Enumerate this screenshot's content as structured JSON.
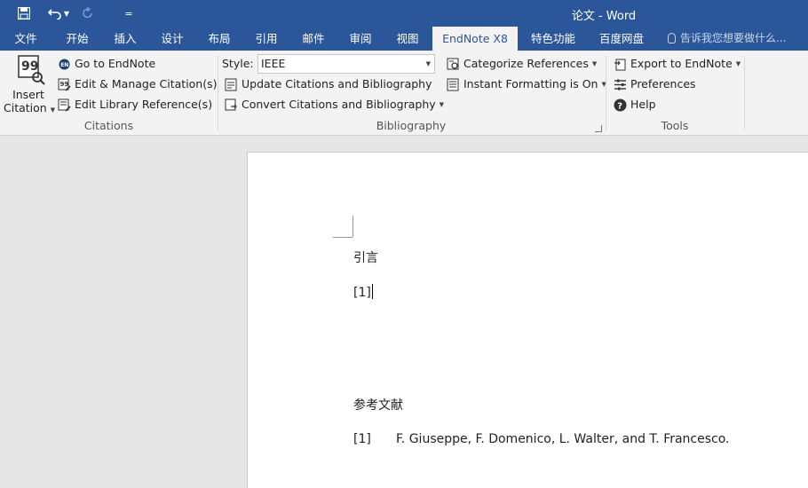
{
  "window": {
    "title": "论文 - Word"
  },
  "qat": {
    "customize_symbol": "="
  },
  "tabs": [
    {
      "label": "文件"
    },
    {
      "label": "开始"
    },
    {
      "label": "插入"
    },
    {
      "label": "设计"
    },
    {
      "label": "布局"
    },
    {
      "label": "引用"
    },
    {
      "label": "邮件"
    },
    {
      "label": "审阅"
    },
    {
      "label": "视图"
    },
    {
      "label": "EndNote X8"
    },
    {
      "label": "特色功能"
    },
    {
      "label": "百度网盘"
    }
  ],
  "tell_me": {
    "text": "告诉我您想要做什么..."
  },
  "ribbon": {
    "citations": {
      "label": "Citations",
      "insert_citation_line1": "Insert",
      "insert_citation_line2": "Citation",
      "go_to_endnote": "Go to EndNote",
      "edit_manage": "Edit & Manage Citation(s)",
      "edit_library": "Edit Library Reference(s)"
    },
    "bibliography": {
      "label": "Bibliography",
      "style_label": "Style:",
      "style_value": "IEEE",
      "update": "Update Citations and Bibliography",
      "convert": "Convert Citations and Bibliography",
      "categorize": "Categorize References",
      "instant_formatting": "Instant Formatting is On"
    },
    "tools": {
      "label": "Tools",
      "export": "Export to EndNote",
      "preferences": "Preferences",
      "help": "Help"
    }
  },
  "document": {
    "heading1": "引言",
    "citation": "[1]",
    "heading2": "参考文献",
    "ref_number": "[1]",
    "ref_text": "F. Giuseppe, F. Domenico, L. Walter, and T. Francesco."
  },
  "colors": {
    "accent": "#2b579a",
    "ribbon_bg": "#f3f3f3",
    "canvas_bg": "#e6e6e6"
  }
}
